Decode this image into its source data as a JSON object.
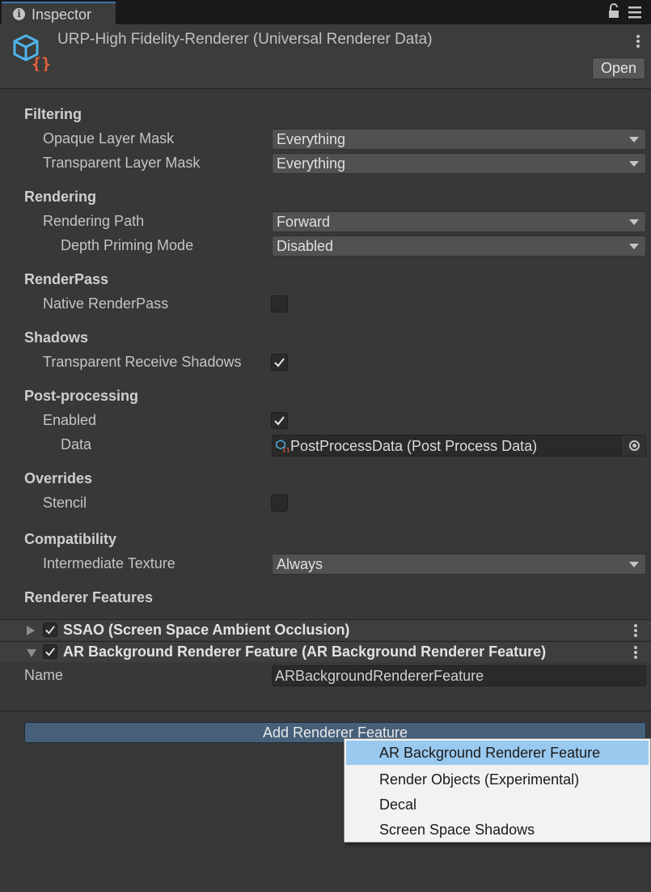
{
  "tab": {
    "title": "Inspector",
    "info_icon": "info-icon",
    "lock_icon": "lock-icon",
    "menu_icon": "kebab-menu-icon"
  },
  "header": {
    "asset_title": "URP-High Fidelity-Renderer (Universal Renderer Data)",
    "asset_icon": "scriptable-object-icon",
    "open_label": "Open"
  },
  "filtering": {
    "title": "Filtering",
    "opaque_label": "Opaque Layer Mask",
    "opaque_value": "Everything",
    "transparent_label": "Transparent Layer Mask",
    "transparent_value": "Everything"
  },
  "rendering": {
    "title": "Rendering",
    "path_label": "Rendering Path",
    "path_value": "Forward",
    "depth_label": "Depth Priming Mode",
    "depth_value": "Disabled"
  },
  "renderpass": {
    "title": "RenderPass",
    "native_label": "Native RenderPass",
    "native_checked": false
  },
  "shadows": {
    "title": "Shadows",
    "receive_label": "Transparent Receive Shadows",
    "receive_checked": true
  },
  "postprocessing": {
    "title": "Post-processing",
    "enabled_label": "Enabled",
    "enabled_checked": true,
    "data_label": "Data",
    "data_value": "PostProcessData (Post Process Data)"
  },
  "overrides": {
    "title": "Overrides",
    "stencil_label": "Stencil",
    "stencil_checked": false
  },
  "compatibility": {
    "title": "Compatibility",
    "intermediate_label": "Intermediate Texture",
    "intermediate_value": "Always"
  },
  "renderer_features": {
    "title": "Renderer Features",
    "items": [
      {
        "title": "SSAO (Screen Space Ambient Occlusion)",
        "enabled": true,
        "expanded": false
      },
      {
        "title": "AR Background Renderer Feature (AR Background Renderer Feature)",
        "enabled": true,
        "expanded": true
      }
    ],
    "name_label": "Name",
    "name_value": "ARBackgroundRendererFeature",
    "add_button": "Add Renderer Feature"
  },
  "popup": {
    "items": [
      {
        "label": "AR Background Renderer Feature",
        "highlighted": true
      },
      {
        "label": "Render Objects (Experimental)",
        "highlighted": false
      },
      {
        "label": "Decal",
        "highlighted": false
      },
      {
        "label": "Screen Space Shadows",
        "highlighted": false
      }
    ]
  },
  "colors": {
    "panel_bg": "#383838",
    "accent_blue": "#46607a",
    "popup_highlight": "#99c9ef"
  }
}
